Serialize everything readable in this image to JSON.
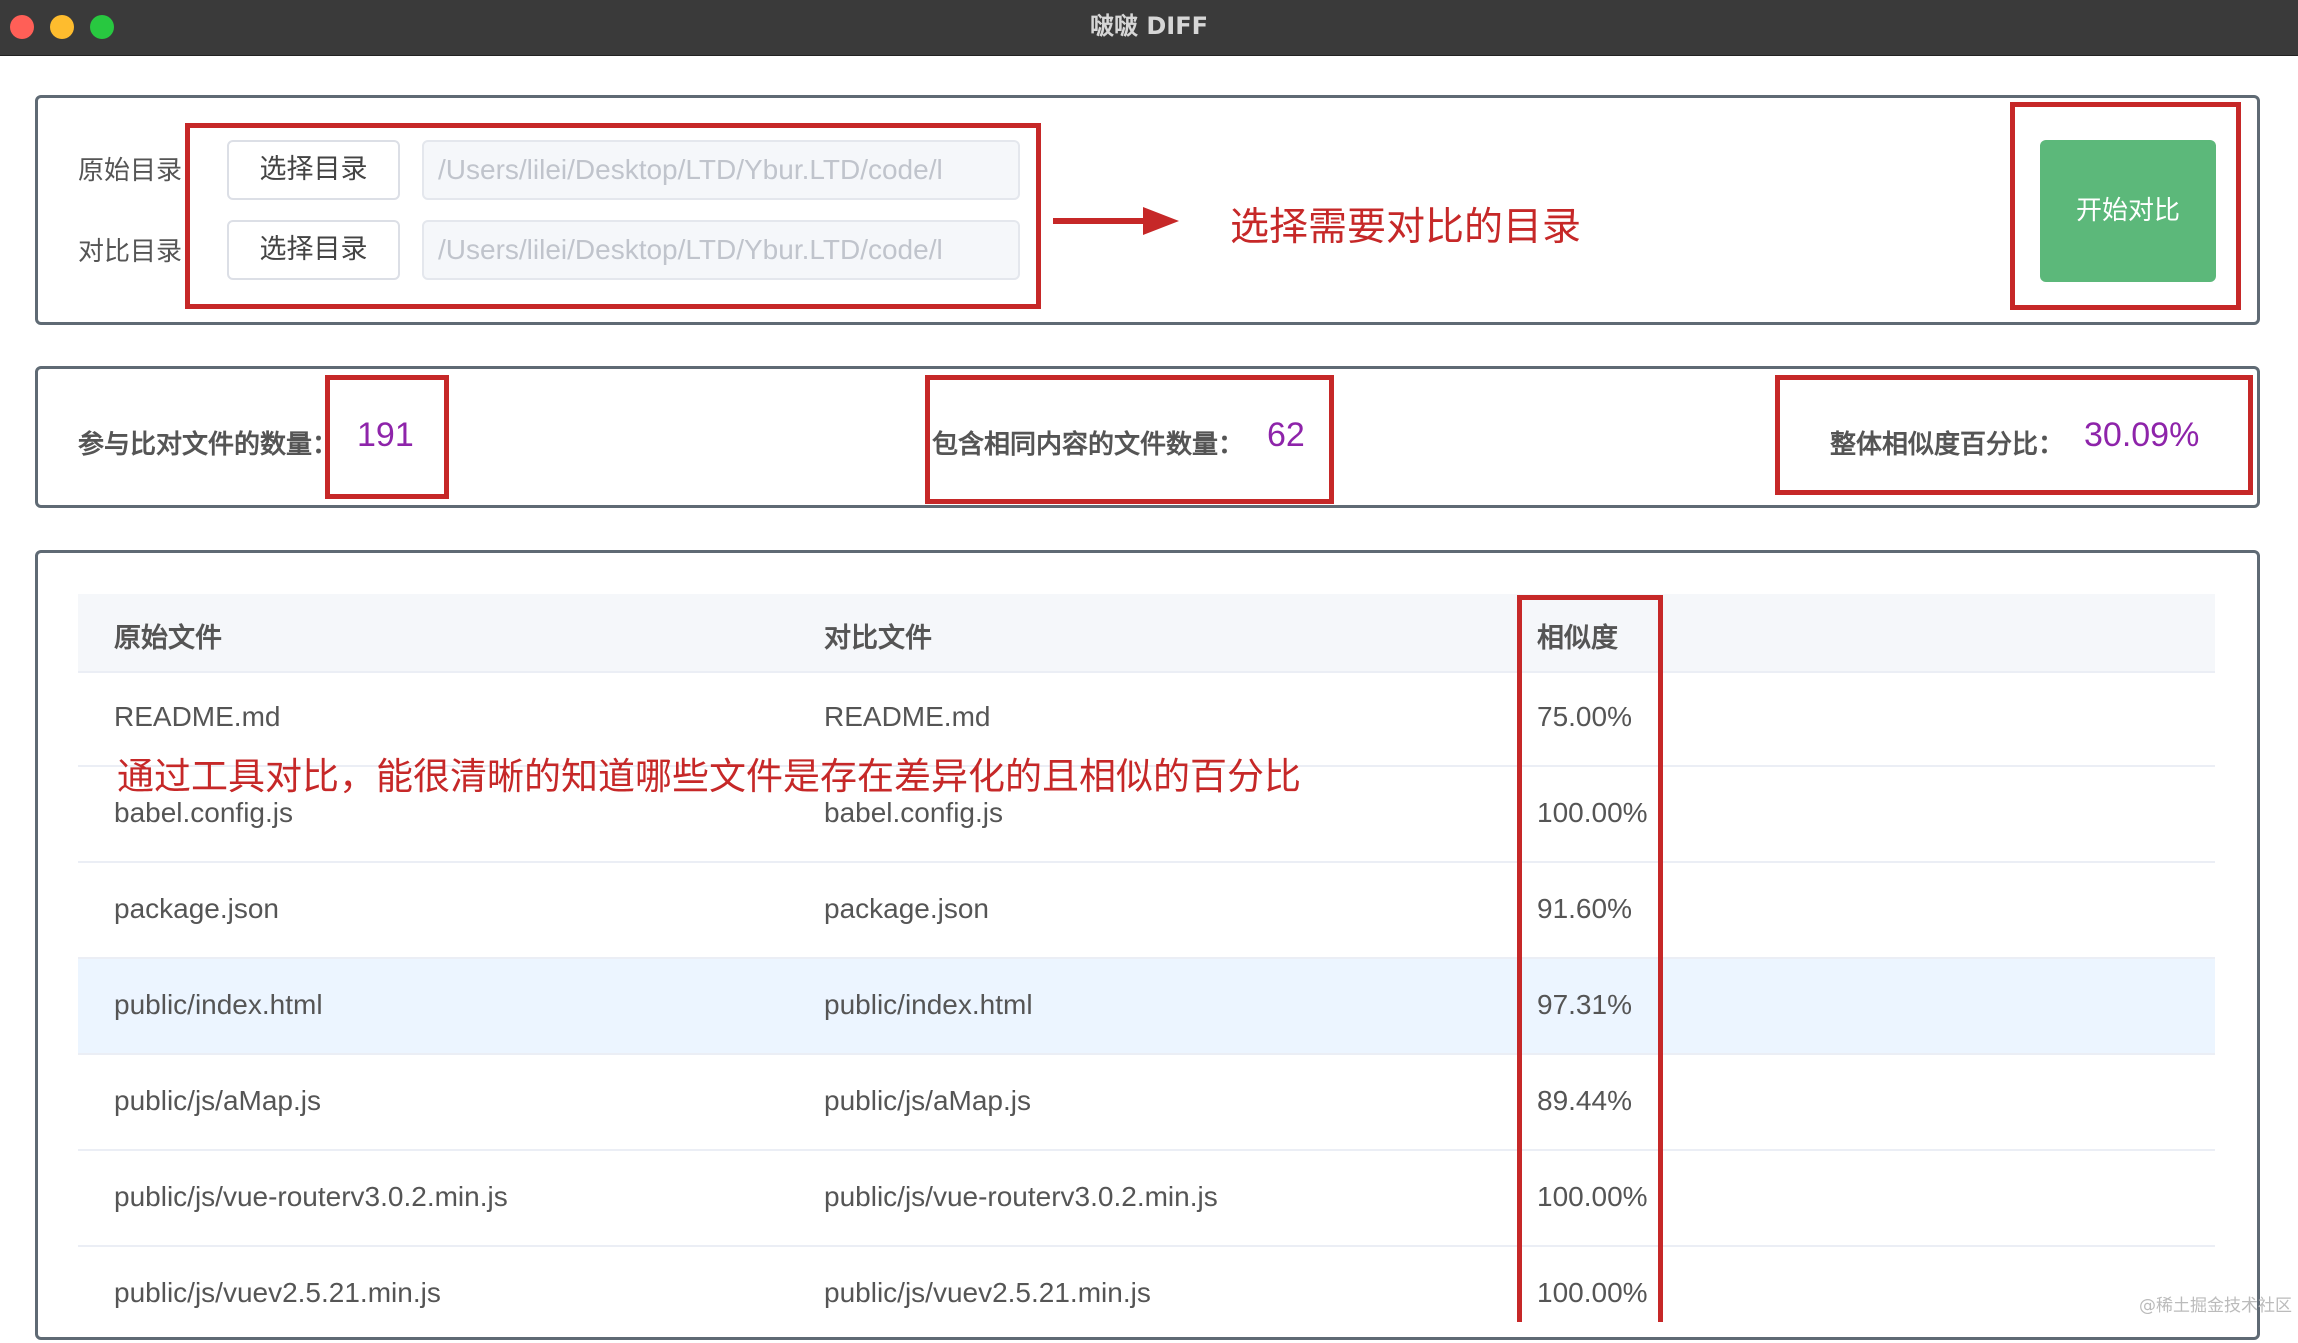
{
  "window": {
    "title": "啵啵 DIFF"
  },
  "dirs": {
    "original_label": "原始目录",
    "compare_label": "对比目录",
    "select_button": "选择目录",
    "original_path": "/Users/lilei/Desktop/LTD/Ybur.LTD/code/l",
    "compare_path": "/Users/lilei/Desktop/LTD/Ybur.LTD/code/l",
    "start_button": "开始对比"
  },
  "stats": {
    "files_label": "参与比对文件的数量：",
    "files_value": "191",
    "same_label": "包含相同内容的文件数量：",
    "same_value": "62",
    "similarity_label": "整体相似度百分比：",
    "similarity_value": "30.09%"
  },
  "annotations": {
    "select_dirs": "选择需要对比的目录",
    "result_note": "通过工具对比，能很清晰的知道哪些文件是存在差异化的且相似的百分比",
    "color": "#c62828"
  },
  "table": {
    "headers": [
      "原始文件",
      "对比文件",
      "相似度"
    ],
    "rows": [
      [
        "README.md",
        "README.md",
        "75.00%"
      ],
      [
        "babel.config.js",
        "babel.config.js",
        "100.00%"
      ],
      [
        "package.json",
        "package.json",
        "91.60%"
      ],
      [
        "public/index.html",
        "public/index.html",
        "97.31%"
      ],
      [
        "public/js/aMap.js",
        "public/js/aMap.js",
        "89.44%"
      ],
      [
        "public/js/vue-routerv3.0.2.min.js",
        "public/js/vue-routerv3.0.2.min.js",
        "100.00%"
      ],
      [
        "public/js/vuev2.5.21.min.js",
        "public/js/vuev2.5.21.min.js",
        "100.00%"
      ]
    ]
  },
  "watermark": "@稀土掘金技术社区",
  "colors": {
    "accent_green": "#5cb87a",
    "value_purple": "#8e24aa",
    "highlight_row": "#ecf5ff"
  }
}
